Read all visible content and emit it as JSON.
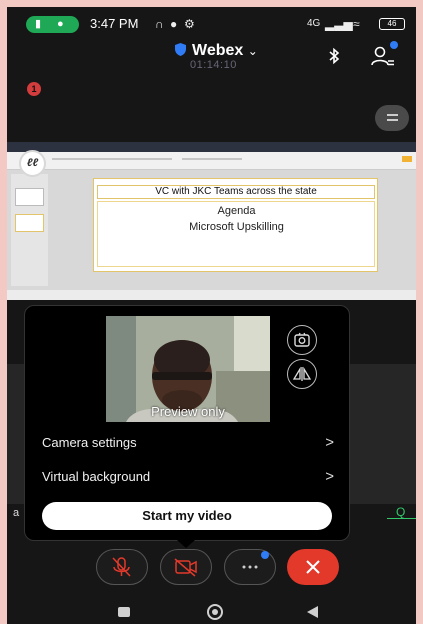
{
  "status_bar": {
    "time": "3:47 PM",
    "battery": "46",
    "network": "4G"
  },
  "header": {
    "app_name": "Webex",
    "call_timer": "01:14:10"
  },
  "notification_badge": "1",
  "shared_slide": {
    "title": "VC with JKC Teams across the state",
    "agenda": "Agenda",
    "topic": "Microsoft Upskilling"
  },
  "video_panel": {
    "preview_label": "Preview only",
    "camera_settings_label": "Camera settings",
    "virtual_background_label": "Virtual background",
    "start_video_label": "Start my video",
    "chevron": ">"
  },
  "side_text": {
    "left": "a",
    "right": "Q"
  },
  "colors": {
    "end_call": "#e2392b",
    "accent_blue": "#2f7cf6",
    "call_pill": "#1fa855",
    "frame": "#f3c9c4"
  },
  "icons": [
    "shield-icon",
    "bluetooth-icon",
    "participants-icon",
    "layout-icon",
    "camera-flip-icon",
    "mirror-icon",
    "mic-muted-icon",
    "video-off-icon",
    "more-icon",
    "end-call-icon"
  ]
}
